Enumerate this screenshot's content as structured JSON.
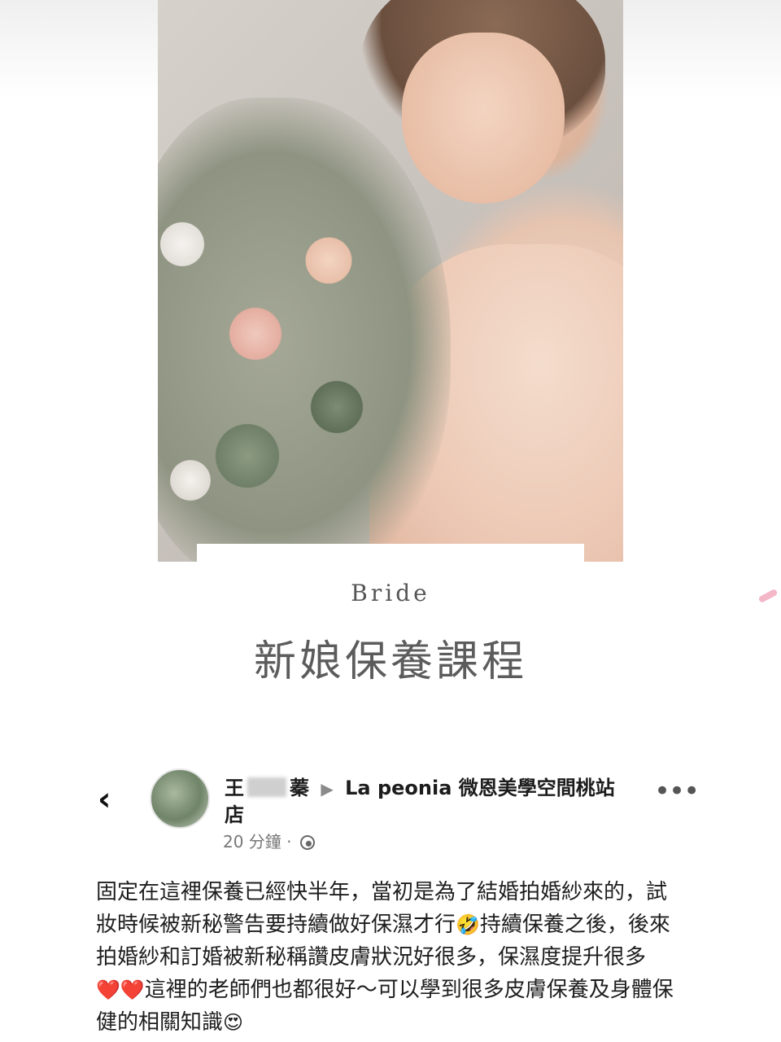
{
  "banner": {
    "heading_en": "Bride",
    "heading_zh": "新娘保養課程"
  },
  "post": {
    "author_visible_prefix": "王",
    "author_visible_suffix": "蓁",
    "arrow": "▶",
    "page_name": "La peonia 微恩美學空間桃站店",
    "time": "20 分鐘",
    "dot": "·",
    "more": "•••",
    "back": "‹",
    "body_parts": [
      "固定在這裡保養已經快半年，當初是為了結婚拍婚紗來的，試妝時候被新秘警告要持續做好保濕才行",
      "🤣",
      "持續保養之後，後來拍婚紗和訂婚被新秘稱讚皮膚狀況好很多，保濕度提升很多",
      "❤️❤️",
      "這裡的老師們也都很好～可以學到很多皮膚保養及身體保健的相關知識",
      "😍"
    ]
  },
  "icons": {
    "back": "chevron-left-icon",
    "more": "more-icon",
    "privacy": "globe-icon"
  },
  "colors": {
    "text": "#1e1e1e",
    "meta": "#777777",
    "accent_pink": "#f3b7c8"
  }
}
